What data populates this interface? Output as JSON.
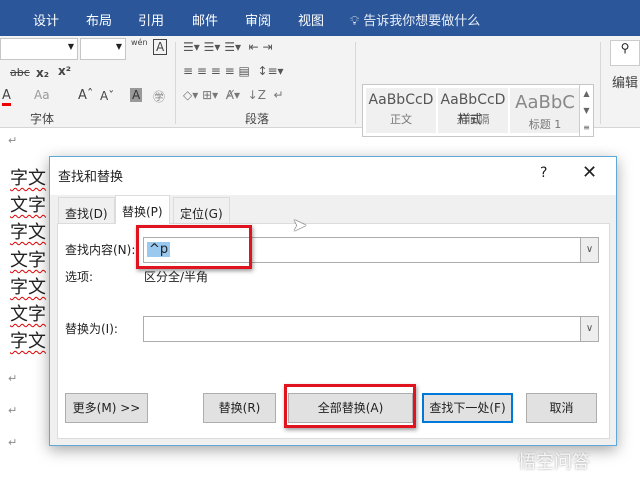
{
  "menu": {
    "tabs": [
      "设计",
      "布局",
      "引用",
      "邮件",
      "审阅",
      "视图"
    ],
    "tell_me": "告诉我你想要做什么"
  },
  "ribbon": {
    "font_group": "字体",
    "paragraph_group": "段落",
    "styles_group": "样式",
    "styles": [
      {
        "preview": "AaBbCcD",
        "name": "正文"
      },
      {
        "preview": "AaBbCcD",
        "name": "无间隔"
      },
      {
        "preview": "AaBbC",
        "name": "标题 1"
      }
    ],
    "edit": "编辑",
    "phonetic": "wén",
    "abc": "abc",
    "font_a": "A",
    "aa": "Aa"
  },
  "document": {
    "lines": [
      "字文",
      "文字",
      "字文",
      "文字",
      "字文",
      "文字",
      "字文"
    ],
    "para_mark": "↵"
  },
  "dialog": {
    "title": "查找和替换",
    "help": "?",
    "close": "✕",
    "tabs": [
      "查找(D)",
      "替换(P)",
      "定位(G)"
    ],
    "find_label": "查找内容(N):",
    "find_value": "^p",
    "options_label": "选项:",
    "options_value": "区分全/半角",
    "replace_label": "替换为(I):",
    "replace_value": "",
    "buttons": {
      "more": "更多(M) >>",
      "replace": "替换(R)",
      "replace_all": "全部替换(A)",
      "find_next": "查找下一处(F)",
      "cancel": "取消"
    }
  },
  "watermark": "悟空问答"
}
